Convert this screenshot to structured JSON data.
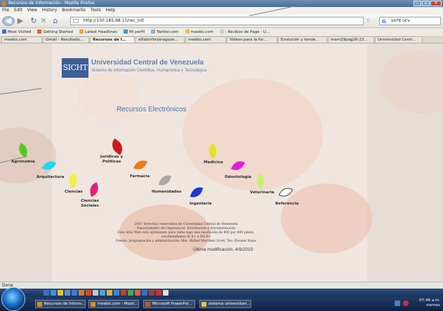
{
  "window": {
    "title": "Recursos de Información - Mozilla Firefox"
  },
  "menu": [
    "File",
    "Edit",
    "View",
    "History",
    "Bookmarks",
    "Tools",
    "Help"
  ],
  "nav": {
    "url": "http://150.185.68.15/rec_inf/",
    "search_value": "sicht ucv"
  },
  "bookmarks": [
    {
      "label": "Most Visited",
      "color": "#3a6fc4"
    },
    {
      "label": "Getting Started",
      "color": "#e0662a"
    },
    {
      "label": "Latest Headlines",
      "color": "#f0a030"
    },
    {
      "label": "Mi perfil",
      "color": "#3a9ad8"
    },
    {
      "label": "Twitter.com",
      "color": "#7ab8e8"
    },
    {
      "label": "meebo.com",
      "color": "#f2c12e"
    },
    {
      "label": ": Recibos de Pago - U...",
      "color": "#cccccc"
    }
  ],
  "tabs": [
    {
      "label": "meebo.com"
    },
    {
      "label": "Gmail - Resultado..."
    },
    {
      "label": "Recursos de I...",
      "active": true
    },
    {
      "label": "elfabinforzaragoza..."
    },
    {
      "label": "meebo.com"
    },
    {
      "label": "Videos para la for..."
    },
    {
      "label": "Evolución y tende..."
    },
    {
      "label": "mem29pag26-23..."
    },
    {
      "label": "Universidad Centr..."
    }
  ],
  "site": {
    "logo": "SICHT",
    "university": "Universidad Central de Venezuela",
    "system": "Sistema de Información Científica, Humanística y Tecnológica",
    "heading": "Recursos Electrónicos"
  },
  "categories": [
    {
      "name": "agronomia",
      "label": "Agronomía",
      "color": "#55cc22"
    },
    {
      "name": "arquitectura",
      "label": "Arquitectura",
      "color": "#22d8f0"
    },
    {
      "name": "ciencias",
      "label": "Ciencias",
      "color": "#f2f03c"
    },
    {
      "name": "ciencias-sociales",
      "label": "Ciencias Sociales",
      "color": "#e0207a"
    },
    {
      "name": "juridicas",
      "label": "Jurídicas y Políticas",
      "color": "#d01818"
    },
    {
      "name": "farmacia",
      "label": "Farmacia",
      "color": "#f07a1a"
    },
    {
      "name": "humanidades",
      "label": "Humanidades",
      "color": "#a9a9a9"
    },
    {
      "name": "ingenieria",
      "label": "Ingeniería",
      "color": "#1a36d8"
    },
    {
      "name": "medicina",
      "label": "Medicina",
      "color": "#e8e020"
    },
    {
      "name": "odontologia",
      "label": "Odontología",
      "color": "#e020d8"
    },
    {
      "name": "veterinaria",
      "label": "Veterinaria",
      "color": "#c8f070"
    },
    {
      "name": "referencia",
      "label": "Referencia",
      "color": "#ffffff"
    }
  ],
  "footer": {
    "lines": [
      "2007 Derechos reservados de Universidad Central de Venezuela",
      "Departamento de Organizació, Información y Documentación",
      "Este Sitio Web está optimizado para verse bajo una resolución de 800 por 600 píxels, recomendamos IE 6+ o NS 6+",
      "Diseño, programación y administración: Msc. Rafael Martínez Scott, Tsu. Eleazar Rojas"
    ],
    "last_modified": "Última modificación: 4/9/2010"
  },
  "status": "Done",
  "taskbar": {
    "tasks": [
      {
        "label": "Recursos de Inform..."
      },
      {
        "label": "meebo.com - Mozil..."
      },
      {
        "label": "Microsoft PowerPoi..."
      },
      {
        "label": "sistema universitari..."
      }
    ],
    "clock": {
      "time": "07:46 a.m.",
      "day": "viernes"
    },
    "quick_launch_colors": [
      "#3a6fc4",
      "#2e9ad0",
      "#e0c030",
      "#6a8ac4",
      "#3d7bd8",
      "#e07a2a",
      "#d84a2a",
      "#c8c8c8",
      "#58a0d0",
      "#e0b040",
      "#3a8ad0",
      "#d03a2a",
      "#4aa850",
      "#e06030",
      "#3a6fc4",
      "#aa3a3a",
      "#c83030",
      "#dddddd"
    ]
  }
}
